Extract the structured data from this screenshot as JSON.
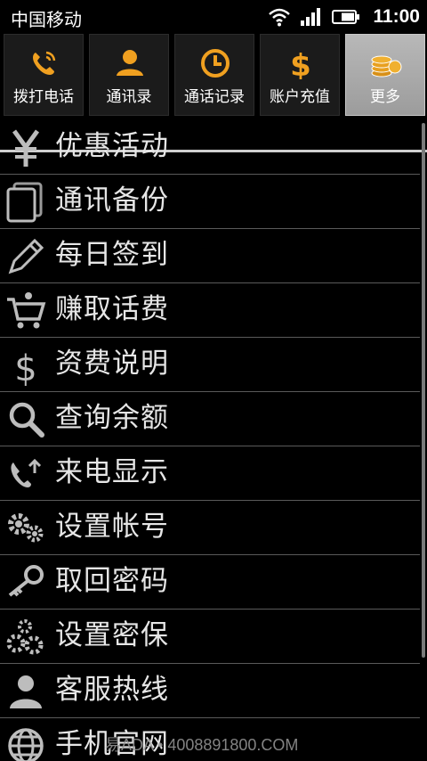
{
  "status_bar": {
    "carrier": "中国移动",
    "time": "11:00"
  },
  "tabs": [
    {
      "label": "拨打电话",
      "icon": "phone-icon"
    },
    {
      "label": "通讯录",
      "icon": "contact-icon"
    },
    {
      "label": "通话记录",
      "icon": "clock-icon"
    },
    {
      "label": "账户充值",
      "icon": "dollar-icon"
    },
    {
      "label": "更多",
      "icon": "coins-icon",
      "active": true
    }
  ],
  "menu": [
    {
      "label": "优惠活动",
      "icon": "yen-icon"
    },
    {
      "label": "通讯备份",
      "icon": "copy-icon"
    },
    {
      "label": "每日签到",
      "icon": "pencil-icon"
    },
    {
      "label": "赚取话费",
      "icon": "cart-icon"
    },
    {
      "label": "资费说明",
      "icon": "dollar-sign-icon"
    },
    {
      "label": "查询余额",
      "icon": "magnifier-icon"
    },
    {
      "label": "来电显示",
      "icon": "incoming-call-icon"
    },
    {
      "label": "设置帐号",
      "icon": "gears-icon"
    },
    {
      "label": "取回密码",
      "icon": "key-icon"
    },
    {
      "label": "设置密保",
      "icon": "gear-cluster-icon"
    },
    {
      "label": "客服热线",
      "icon": "person-icon"
    },
    {
      "label": "手机官网",
      "icon": "globe-icon"
    }
  ],
  "watermark": "易ADA • 4008891800.COM",
  "colors": {
    "tab_accent": "#f0a020",
    "active_tab": "#a8a8a8",
    "divider": "#5a5a5a"
  }
}
